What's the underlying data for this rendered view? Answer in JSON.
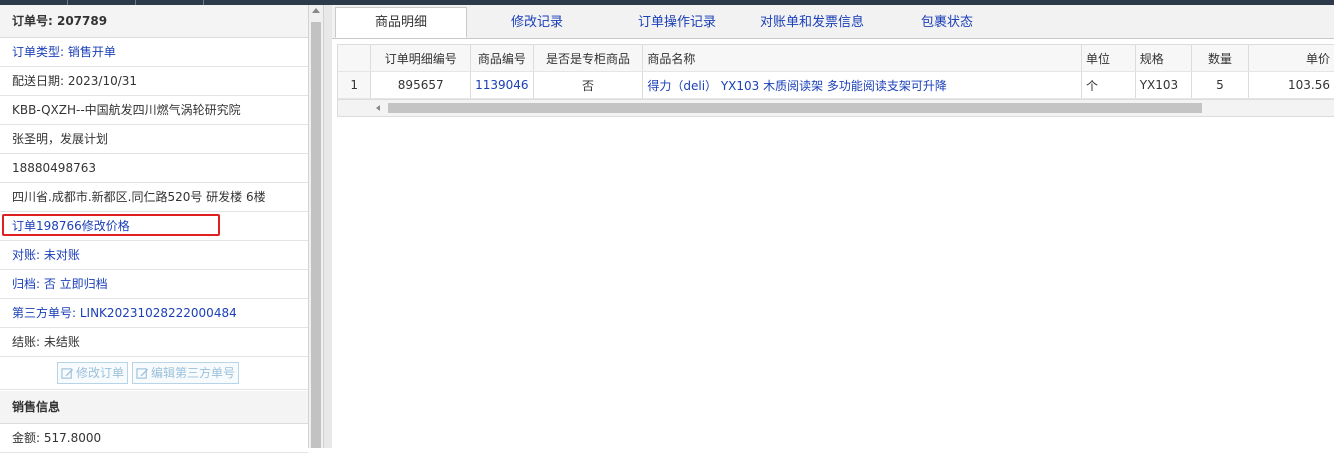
{
  "order": {
    "number_label": "订单号: 207789",
    "type_label": "订单类型: 销售开单",
    "delivery_date": "配送日期: 2023/10/31",
    "customer": "KBB-QXZH--中国航发四川燃气涡轮研究院",
    "contact": "张圣明，发展计划",
    "phone": "18880498763",
    "address": "四川省.成都市.新都区.同仁路520号 研发楼 6楼",
    "price_change_note": "订单198766修改价格",
    "reconcile": "对账: 未对账",
    "archive": "归档:  否 立即归档",
    "third_party_no": "第三方单号: LINK20231028222000484",
    "settlement": "结账: 未结账",
    "buttons": {
      "edit_order": "修改订单",
      "edit_third_party": "编辑第三方单号"
    }
  },
  "sales": {
    "heading": "销售信息",
    "amount": "金额: 517.8000"
  },
  "tabs": [
    "商品明细",
    "修改记录",
    "订单操作记录",
    "对账单和发票信息",
    "包裹状态"
  ],
  "table": {
    "headers": [
      "",
      "订单明细编号",
      "商品编号",
      "是否是专柜商品",
      "商品名称",
      "单位",
      "规格",
      "数量",
      "单价"
    ],
    "rows": [
      [
        "1",
        "895657",
        "1139046",
        "否",
        "得力（deli） YX103 木质阅读架 多功能阅读支架可升降",
        "个",
        "YX103",
        "5",
        "103.56"
      ]
    ]
  },
  "colors": {
    "link": "#1a3fb8",
    "highlight_border": "#e02020",
    "topbar": "#2d3a4a"
  },
  "icons": {
    "edit": "edit-icon"
  }
}
